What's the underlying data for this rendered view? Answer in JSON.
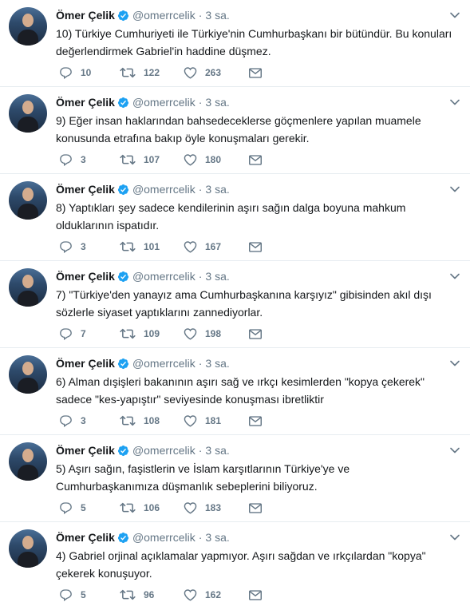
{
  "author": {
    "name": "Ömer Çelik",
    "handle": "@omerrcelik",
    "separator": "·"
  },
  "colors": {
    "text": "#14171a",
    "muted": "#657786",
    "verified": "#1da1f2",
    "divider": "#e6ecf0"
  },
  "icons": {
    "reply": "reply-icon",
    "retweet": "retweet-icon",
    "like": "heart-icon",
    "dm": "envelope-icon",
    "menu": "chevron-down-icon",
    "verified": "verified-badge-icon"
  },
  "tweets": [
    {
      "time": "3 sa.",
      "text": "10) Türkiye Cumhuriyeti ile Türkiye'nin Cumhurbaşkanı bir bütündür. Bu konuları değerlendirmek Gabriel'in haddine düşmez.",
      "replies": "10",
      "retweets": "122",
      "likes": "263"
    },
    {
      "time": "3 sa.",
      "text": "9) Eğer insan haklarından bahsedeceklerse göçmenlere yapılan muamele konusunda etrafına bakıp öyle konuşmaları gerekir.",
      "replies": "3",
      "retweets": "107",
      "likes": "180"
    },
    {
      "time": "3 sa.",
      "text": "8) Yaptıkları şey sadece kendilerinin aşırı sağın dalga boyuna mahkum olduklarının ispatıdır.",
      "replies": "3",
      "retweets": "101",
      "likes": "167"
    },
    {
      "time": "3 sa.",
      "text": "7) \"Türkiye'den yanayız ama Cumhurbaşkanına karşıyız\" gibisinden akıl dışı sözlerle siyaset yaptıklarını zannediyorlar.",
      "replies": "7",
      "retweets": "109",
      "likes": "198"
    },
    {
      "time": "3 sa.",
      "text": "6) Alman dışişleri bakanının aşırı sağ ve ırkçı kesimlerden \"kopya çekerek\" sadece \"kes-yapıştır\" seviyesinde konuşması ibretliktir",
      "replies": "3",
      "retweets": "108",
      "likes": "181"
    },
    {
      "time": "3 sa.",
      "text": "5) Aşırı sağın, faşistlerin ve İslam karşıtlarının Türkiye'ye ve Cumhurbaşkanımıza düşmanlık sebeplerini biliyoruz.",
      "replies": "5",
      "retweets": "106",
      "likes": "183"
    },
    {
      "time": "3 sa.",
      "text": "4) Gabriel orjinal açıklamalar yapmıyor. Aşırı sağdan ve ırkçılardan \"kopya\" çekerek konuşuyor.",
      "replies": "5",
      "retweets": "96",
      "likes": "162"
    }
  ]
}
